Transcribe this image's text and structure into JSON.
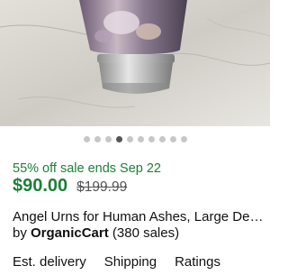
{
  "listing": {
    "image_alt": "vase-photo",
    "carousel": {
      "count": 10,
      "active_index": 3
    },
    "sale_text": "55% off sale ends Sep 22",
    "price": "$90.00",
    "original_price": "$199.99",
    "title": "Angel Urns for Human Ashes, Large Decorative Urn",
    "seller_prefix": "by",
    "seller_name": "OrganicCart",
    "seller_sales": "(380 sales)"
  },
  "tabs": [
    {
      "label": "Est. delivery"
    },
    {
      "label": "Shipping"
    },
    {
      "label": "Ratings"
    }
  ],
  "colors": {
    "sale_green": "#1e7f39",
    "dot_active": "#555555",
    "dot_inactive": "#c7c7c7"
  }
}
